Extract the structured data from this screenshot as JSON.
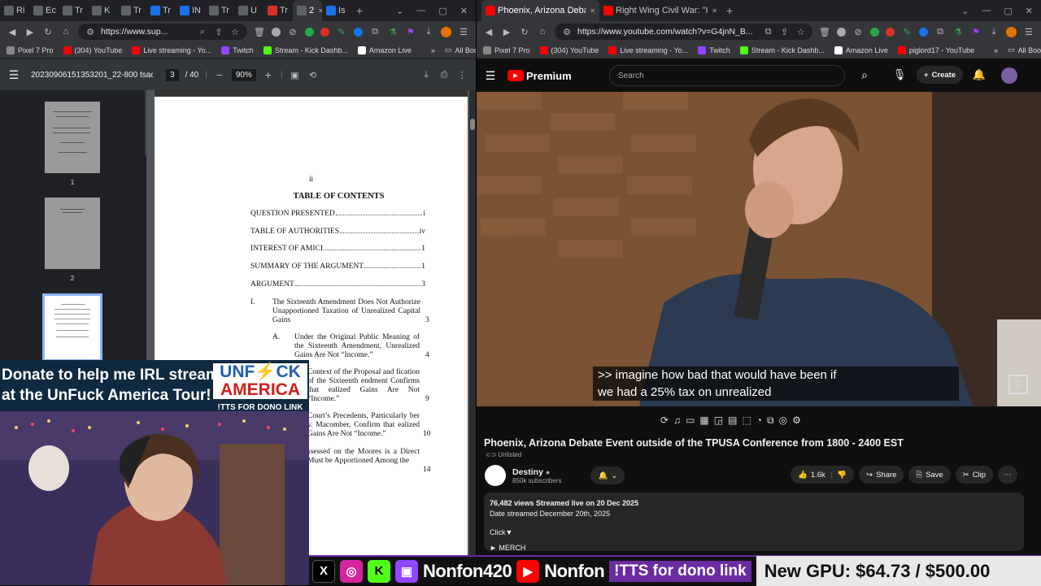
{
  "left_window": {
    "tabs": [
      "Ri",
      "Ec",
      "Tr",
      "K",
      "Tr",
      "Tr",
      "IN",
      "Tr",
      "U",
      "Tr",
      "2",
      "Is"
    ],
    "active_tab_index": 10,
    "address": "https://www.sup...",
    "bookmarks": [
      "Pixel 7 Pro",
      "(304) YouTube",
      "Live streaming - Yo...",
      "Twitch",
      "Stream - Kick Dashb...",
      "Amazon Live"
    ],
    "all_bookmarks": "All Bookmarks",
    "pdf": {
      "filename": "20230906151353201_22-800 tsac Me...",
      "page_current": "3",
      "page_total": "/ 40",
      "zoom": "90%",
      "thumb_labels": [
        "1",
        "2"
      ],
      "page_numeral": "ii",
      "heading": "TABLE OF CONTENTS",
      "toc": [
        {
          "label": "QUESTION PRESENTED",
          "page": "i"
        },
        {
          "label": "TABLE OF AUTHORITIES",
          "page": "iv"
        },
        {
          "label": "INTEREST OF AMICI",
          "page": "1"
        },
        {
          "label": "SUMMARY OF THE ARGUMENT",
          "page": "1"
        },
        {
          "label": "ARGUMENT",
          "page": "3"
        }
      ],
      "toc_I_num": "I.",
      "toc_I": "The Sixteenth Amendment Does Not Authorize Unapportioned Taxation of Unrealized Capital Gains",
      "toc_I_page": "3",
      "toc_A_num": "A.",
      "toc_A": "Under the Original Public Meaning of the Sixteenth Amendment, Unrealized Gains Are Not “Income.”",
      "toc_A_page": "4",
      "toc_B": "Context of the Proposal and fication of the Sixteenth endment Confirms that ealized Gains Are Not “Income.”",
      "toc_B_page": "9",
      "toc_C": "Court’s Precedents, Particularly ber v. Macomber, Confirm that ealized Gains Are Not “Income.”",
      "toc_C_page": "10",
      "toc_D": "ssessed on the Moores is a Direct Must be Apportioned Among the",
      "toc_D_page": "14"
    }
  },
  "right_window": {
    "tabs": [
      "Phoenix, Arizona Debate E",
      "Right Wing Civil War: \"Israel &"
    ],
    "address": "https://www.youtube.com/watch?v=G4jnN_B...",
    "bookmarks": [
      "Pixel 7 Pro",
      "(304) YouTube",
      "Live streaming - Yo...",
      "Twitch",
      "Stream - Kick Dashb...",
      "Amazon Live",
      "piglord17 - YouTube"
    ],
    "all_bookmarks": "All Bookmarks",
    "youtube": {
      "logo": "Premium",
      "search_placeholder": "Search",
      "create_label": "Create",
      "caption_line1": ">> imagine how bad that would have been if",
      "caption_line2": "we had a 25% tax on unrealized",
      "title": "Phoenix, Arizona Debate Event outside of the TPUSA Conference from 1800 - 2400 EST",
      "visibility": "Unlisted",
      "channel": "Destiny",
      "subscribers": "850k subscribers",
      "likes": "1.6k",
      "share": "Share",
      "save": "Save",
      "clip": "Clip",
      "stats": "76,482 views  Streamed live on 20 Dec 2025",
      "date_streamed": "Date streamed December 20th, 2025",
      "click": "Click▼",
      "merch": "► MERCH"
    }
  },
  "overlay": {
    "donate_line1": "Donate to help me  IRL stream",
    "donate_line2": "at the UnFuck America Tour!",
    "brand_line1": "UNF⚡CK",
    "brand_line2": "AMERICA",
    "tts_link": "!TTS FOR DONO LINK",
    "handle1": "Nonfon420",
    "handle2": "Nonfon",
    "tts_bar": "!TTS for dono link",
    "gpu_goal": "New GPU: $64.73 / $500.00"
  }
}
